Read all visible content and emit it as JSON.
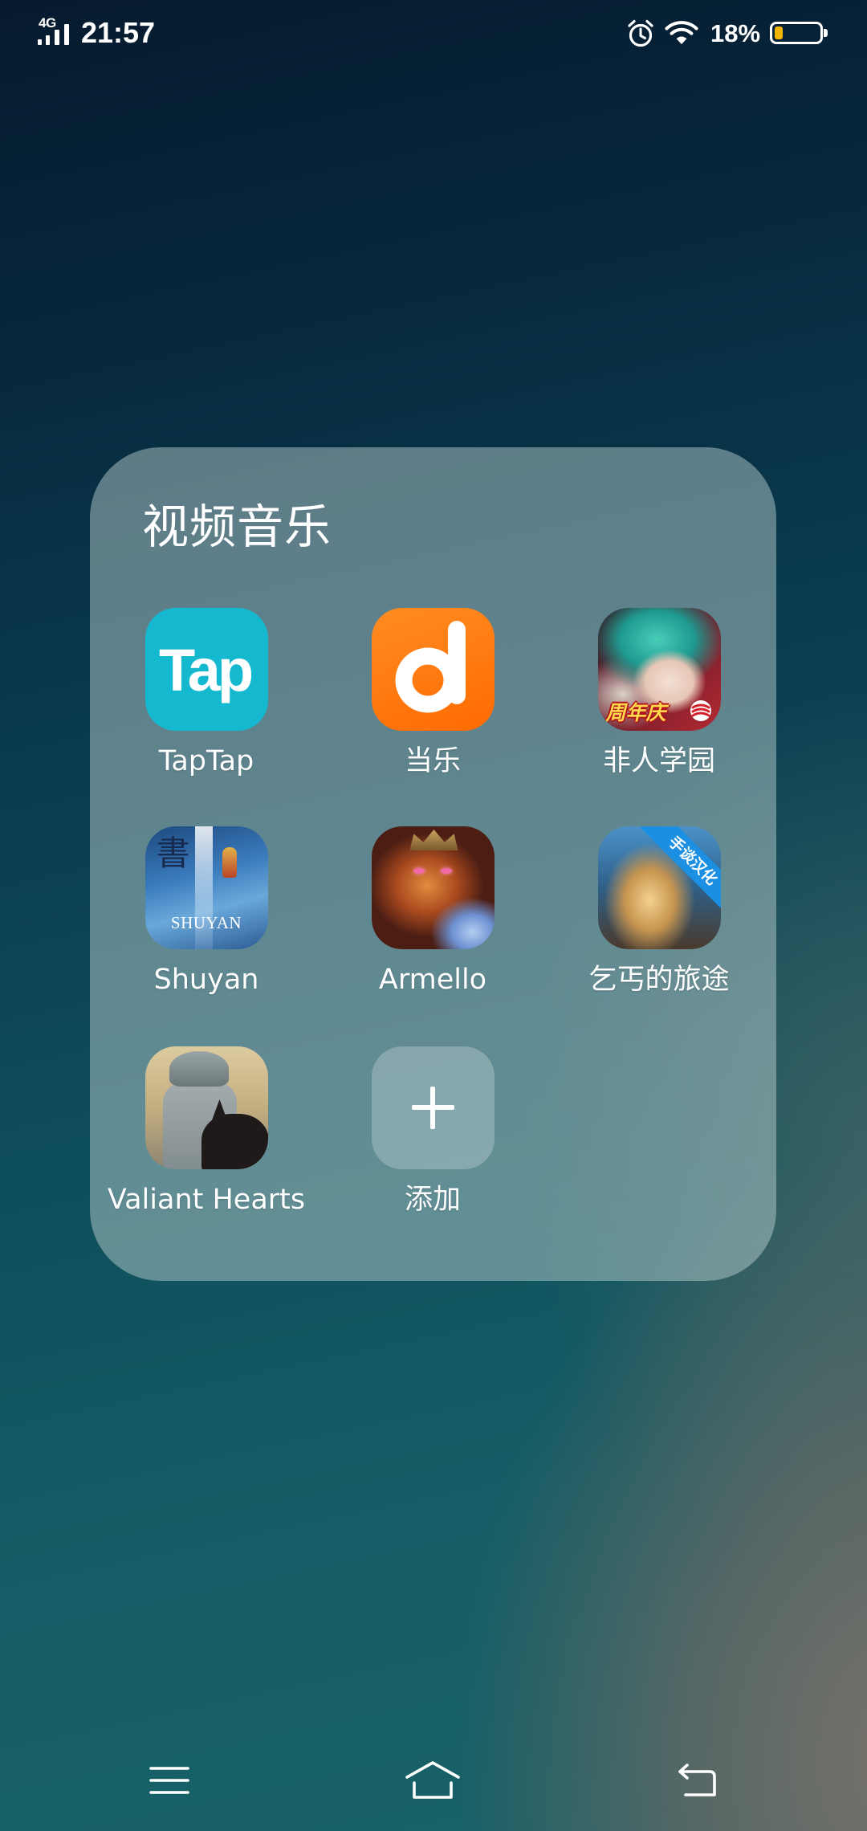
{
  "status_bar": {
    "network": "4G",
    "time": "21:57",
    "battery_text": "18%",
    "battery_level": 0.18,
    "icons": [
      "signal-icon",
      "alarm-icon",
      "wifi-icon",
      "battery-icon"
    ]
  },
  "folder": {
    "title": "视频音乐",
    "apps": [
      {
        "label": "TapTap",
        "icon": "taptap-app-icon",
        "icon_text": "Tap"
      },
      {
        "label": "当乐",
        "icon": "dangle-app-icon"
      },
      {
        "label": "非人学园",
        "icon": "feiren-xueyuan-app-icon",
        "icon_text": "周年庆"
      },
      {
        "label": "Shuyan",
        "icon": "shuyan-app-icon",
        "icon_text": "SHUYAN",
        "icon_glyph": "書"
      },
      {
        "label": "Armello",
        "icon": "armello-app-icon"
      },
      {
        "label": "乞丐的旅途",
        "icon": "beggar-journey-app-icon",
        "icon_text": "手谈汉化"
      },
      {
        "label": "Valiant Hearts",
        "icon": "valiant-hearts-app-icon"
      }
    ],
    "add_button": {
      "label": "添加",
      "icon": "plus-icon"
    }
  },
  "nav_bar": {
    "icons": [
      "menu-icon",
      "home-icon",
      "back-icon"
    ]
  },
  "colors": {
    "taptap_teal": "#15b9cf",
    "dangle_orange": "#ff7a10",
    "battery_yellow": "#f6b600",
    "text_white": "#ffffff"
  }
}
